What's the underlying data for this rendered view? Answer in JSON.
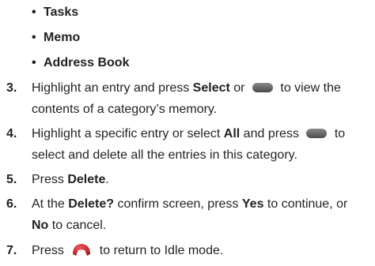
{
  "bullets": [
    "Tasks",
    "Memo",
    "Address Book"
  ],
  "bullet_marker": "•",
  "steps": {
    "s3": {
      "num": "3.",
      "l1a": "Highlight an entry and press ",
      "l1b": "Select",
      "l1c": " or ",
      "l1d": " to view the",
      "l2": "contents of a category’s memory.",
      "key_icon": "menu-select-key-icon"
    },
    "s4": {
      "num": "4.",
      "l1a": "Highlight a specific entry or select ",
      "l1b": "All",
      "l1c": " and press ",
      "l1d": " to",
      "l2": "select and delete all the entries in this category.",
      "key_icon": "menu-select-key-icon"
    },
    "s5": {
      "num": "5.",
      "l1a": "Press ",
      "l1b": "Delete",
      "l1c": "."
    },
    "s6": {
      "num": "6.",
      "l1a": "At the ",
      "l1b": "Delete?",
      "l1c": " confirm screen, press ",
      "l1d": "Yes",
      "l1e": " to continue, or",
      "l2a": "No",
      "l2b": " to cancel."
    },
    "s7": {
      "num": "7.",
      "l1a": "Press ",
      "l1b": " to return to Idle mode.",
      "key_icon": "end-call-key-icon"
    }
  },
  "colors": {
    "text": "#231f20",
    "end_key": "#c8102e",
    "menu_key": "#5a5a5a"
  }
}
